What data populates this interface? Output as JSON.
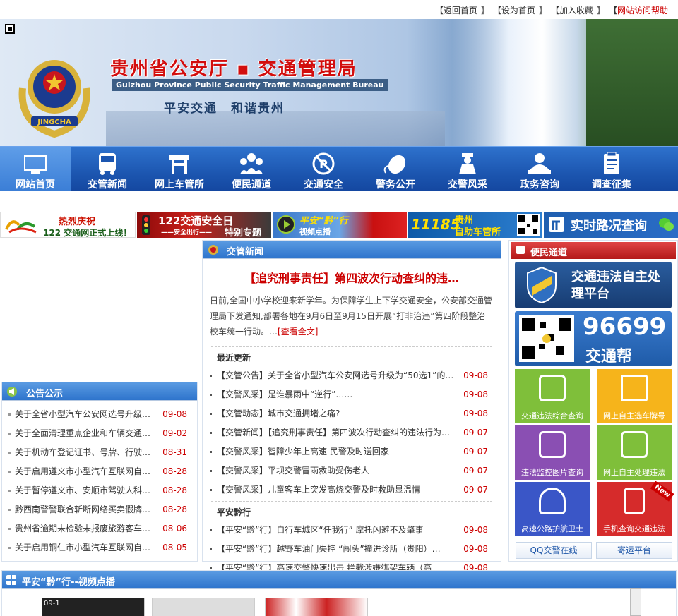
{
  "toplinks": {
    "home": "返回首页",
    "sethome": "设为首页",
    "favorite": "加入收藏",
    "help": "网站访问帮助",
    "lb": "【",
    "rb": "】"
  },
  "banner": {
    "title": "贵州省公安厅 ▪ 交通管理局",
    "subtitle": "Guizhou Province Public Security Traffic Management Bureau",
    "slogan": "平安交通　和谐贵州",
    "emblem_text": "JINGCHA"
  },
  "nav": [
    "网站首页",
    "交管新闻",
    "网上车管所",
    "便民通道",
    "交通安全",
    "警务公开",
    "交警风采",
    "政务咨询",
    "调查征集"
  ],
  "strips": {
    "s1_top": "热烈庆祝",
    "s1_bottom": "122 交通网正式上线！",
    "s2_main": "122交通安全日",
    "s2_sub": "——安全出行——",
    "s2_tag": "特别专题",
    "s3_main": "平安“黔”行",
    "s3_sub": "视频点播",
    "s4_main": "11185",
    "s4_a": "贵州",
    "s4_b": "自助车管所",
    "s5_main": "实时路况查询"
  },
  "announce": {
    "title": "公告公示",
    "items": [
      {
        "text": "关于全省小型汽车公安网选号升级…",
        "date": "09-08"
      },
      {
        "text": "关于全面清理重点企业和车辆交通…",
        "date": "09-02"
      },
      {
        "text": "关于机动车登记证书、号牌、行驶…",
        "date": "08-31"
      },
      {
        "text": "关于启用遵义市小型汽车互联网自…",
        "date": "08-28"
      },
      {
        "text": "关于暂停遵义市、安顺市驾驶人科…",
        "date": "08-28"
      },
      {
        "text": "黔西南警警联合斩断网络买卖假牌…",
        "date": "08-28"
      },
      {
        "text": "贵州省逾期未检验未报废旅游客车…",
        "date": "08-06"
      },
      {
        "text": "关于启用铜仁市小型汽车互联网自…",
        "date": "08-05"
      }
    ]
  },
  "news": {
    "title": "交管新闻",
    "headline": "【追究刑事责任】第四波次行动查纠的违…",
    "summary": "日前,全国中小学校迎来新学年。为保障学生上下学交通安全，公安部交通管理局下发通知,部署各地在9月6日至9月15日开展“打非治违”第四阶段整治校车统一行动。…",
    "more": "[查看全文]",
    "recent_label": "最近更新",
    "recent": [
      {
        "text": "【交管公告】关于全省小型汽车公安网选号升级为“50选1”的…",
        "date": "09-08"
      },
      {
        "text": "【交警风采】是谁暴雨中“逆行”……",
        "date": "09-08"
      },
      {
        "text": "【交管动态】城市交通拥堵之痛?",
        "date": "09-08"
      },
      {
        "text": "【交管新闻】【追究刑事责任】第四波次行动查纠的违法行为…",
        "date": "09-07"
      },
      {
        "text": "【交警风采】智障少年上高速  民警及时送回家",
        "date": "09-07"
      },
      {
        "text": "【交警风采】平坝交警冒雨救助受伤老人",
        "date": "09-07"
      },
      {
        "text": "【交警风采】儿童客车上突发高烧交警及时救助显温情",
        "date": "09-07"
      }
    ],
    "safe_label": "平安黔行",
    "safe": [
      {
        "text": "【平安“黔”行】自行车城区“任我行”  摩托闪避不及肇事",
        "date": "09-08"
      },
      {
        "text": "【平安“黔”行】越野车油门失控 “闯头”撞进诊所（贵阳）…",
        "date": "09-08"
      },
      {
        "text": "【平安“黔”行】高速交警快速出击 拦截涉嫌绑架车辆（高",
        "date": "09-08"
      }
    ]
  },
  "service": {
    "title": "便民通道",
    "banner1": "交通违法自主处理平台",
    "banner2_num": "96699",
    "banner2_txt": "交通帮",
    "tiles": [
      {
        "label": "交通违法综合查询",
        "color": "#7fbf3a"
      },
      {
        "label": "网上自主选车牌号",
        "color": "#f6b41b"
      },
      {
        "label": "违法监控图片查询",
        "color": "#8a4fb3"
      },
      {
        "label": "网上自主处理违法",
        "color": "#7fbf3a"
      },
      {
        "label": "高速公路护航卫士",
        "color": "#3a56c7"
      },
      {
        "label": "手机查询交通违法",
        "color": "#d62b2b"
      }
    ],
    "new_badge": "New",
    "qq": "QQ交警在线",
    "mail": "寄运平台"
  },
  "video": {
    "title": "平安“黔”行--视频点播",
    "thumb1_text": "09-1"
  }
}
